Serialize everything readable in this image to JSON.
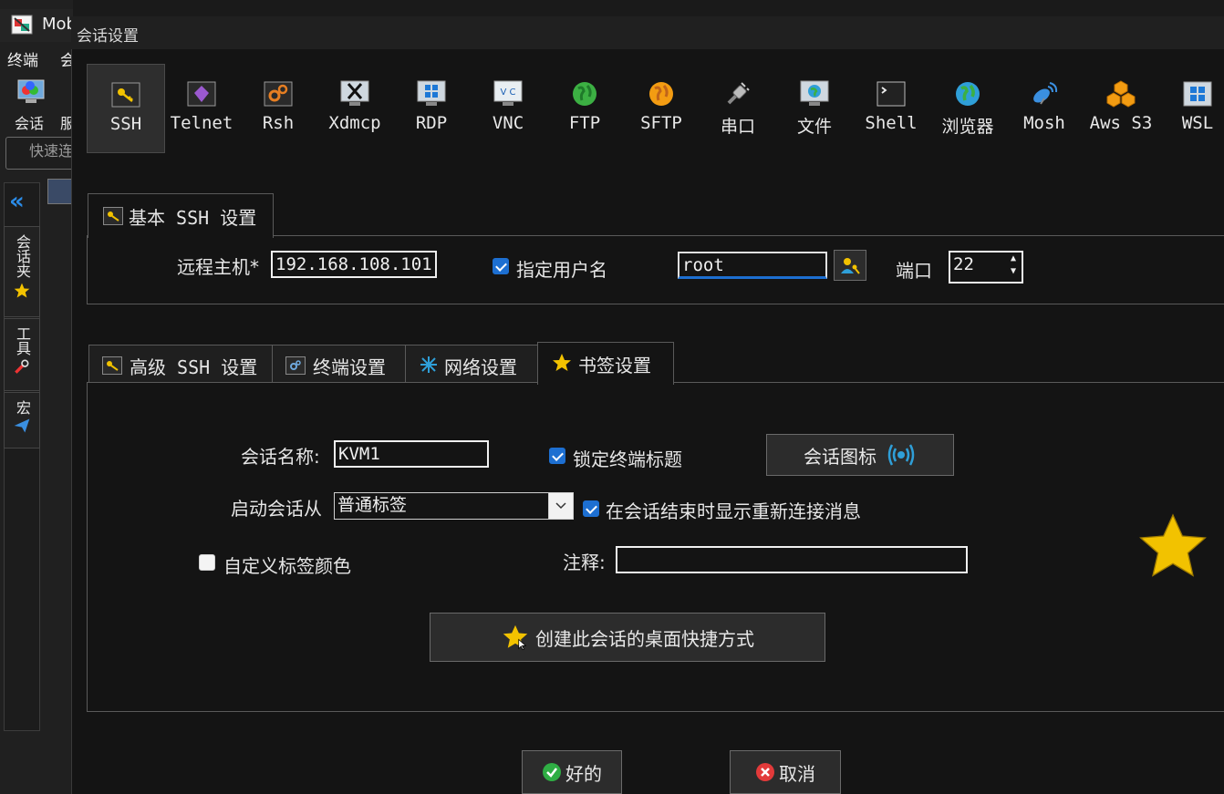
{
  "background_app": {
    "title": "Mob",
    "menu_1": "终端",
    "menu_2": "会",
    "tool_1": "会话",
    "tool_2": "服",
    "quick_connect": "快速连",
    "sidebar_tabs": [
      "会话夹",
      "工具",
      "宏"
    ]
  },
  "dialog": {
    "title": "会话设置",
    "protocols": [
      {
        "label": "SSH",
        "icon": "key-icon"
      },
      {
        "label": "Telnet",
        "icon": "gem-icon"
      },
      {
        "label": "Rsh",
        "icon": "gears-icon"
      },
      {
        "label": "Xdmcp",
        "icon": "x-monitor-icon"
      },
      {
        "label": "RDP",
        "icon": "windows-monitor-icon"
      },
      {
        "label": "VNC",
        "icon": "vnc-monitor-icon"
      },
      {
        "label": "FTP",
        "icon": "globe-green-icon"
      },
      {
        "label": "SFTP",
        "icon": "globe-orange-icon"
      },
      {
        "label": "串口",
        "icon": "serial-plug-icon"
      },
      {
        "label": "文件",
        "icon": "file-monitor-icon"
      },
      {
        "label": "Shell",
        "icon": "shell-icon"
      },
      {
        "label": "浏览器",
        "icon": "browser-globe-icon"
      },
      {
        "label": "Mosh",
        "icon": "satellite-icon"
      },
      {
        "label": "Aws S3",
        "icon": "aws-cubes-icon"
      },
      {
        "label": "WSL",
        "icon": "windows-icon"
      }
    ],
    "basic": {
      "tab_label": "基本 SSH 设置",
      "remote_host_label": "远程主机*",
      "remote_host_value": "192.168.108.101",
      "specify_user_label": "指定用户名",
      "specify_user_checked": true,
      "username_value": "root",
      "port_label": "端口",
      "port_value": "22"
    },
    "tabs": [
      {
        "label": "高级 SSH 设置",
        "active": false
      },
      {
        "label": "终端设置",
        "active": false
      },
      {
        "label": "网络设置",
        "active": false
      },
      {
        "label": "书签设置",
        "active": true
      }
    ],
    "bookmark": {
      "session_name_label": "会话名称:",
      "session_name_value": "KVM1",
      "lock_title_label": "锁定终端标题",
      "lock_title_checked": true,
      "session_icon_button": "会话图标",
      "start_from_label": "启动会话从",
      "start_from_value": "普通标签",
      "reconnect_msg_label": "在会话结束时显示重新连接消息",
      "reconnect_msg_checked": true,
      "custom_color_label": "自定义标签颜色",
      "custom_color_checked": false,
      "comment_label": "注释:",
      "comment_value": "",
      "desktop_shortcut_button": "创建此会话的桌面快捷方式"
    },
    "ok_button": "好的",
    "cancel_button": "取消"
  },
  "colors": {
    "accent_blue": "#1d6fd1",
    "star_yellow": "#f2c200",
    "ok_green": "#2fae44",
    "cancel_red": "#e23a3a"
  }
}
